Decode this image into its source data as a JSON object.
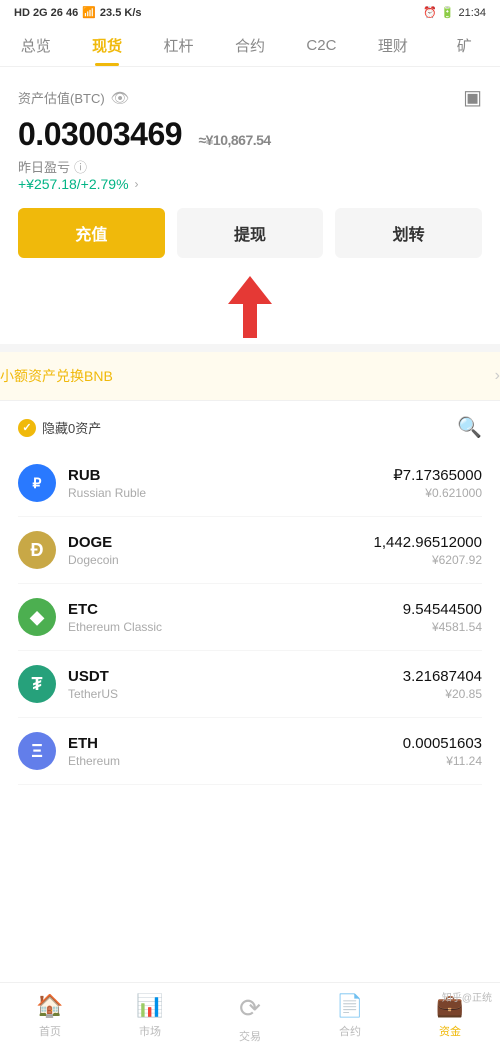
{
  "statusBar": {
    "left": "HD 2G 26 46",
    "network": "23.5 K/s",
    "time": "21:34",
    "battery": "20"
  },
  "navTabs": [
    {
      "id": "overview",
      "label": "总览",
      "active": false
    },
    {
      "id": "spot",
      "label": "现货",
      "active": true
    },
    {
      "id": "leverage",
      "label": "杠杆",
      "active": false
    },
    {
      "id": "contract",
      "label": "合约",
      "active": false
    },
    {
      "id": "c2c",
      "label": "C2C",
      "active": false
    },
    {
      "id": "finance",
      "label": "理财",
      "active": false
    },
    {
      "id": "mining",
      "label": "矿",
      "active": false
    }
  ],
  "asset": {
    "label": "资产估值(BTC)",
    "value": "0.03003469",
    "cny": "≈¥10,867.54",
    "pnlLabel": "昨日盈亏",
    "pnlValue": "+¥257.18/+2.79%"
  },
  "buttons": {
    "recharge": "充值",
    "withdraw": "提现",
    "transfer": "划转"
  },
  "bnbBanner": {
    "text": "小额资产兑换BNB"
  },
  "assetListHeader": {
    "hideZero": "隐藏0资产"
  },
  "coins": [
    {
      "id": "rub",
      "symbol": "RUB",
      "name": "Russian Ruble",
      "amount": "₽7.17365000",
      "cny": "¥0.621000",
      "iconLabel": "₽",
      "iconClass": "rub"
    },
    {
      "id": "doge",
      "symbol": "DOGE",
      "name": "Dogecoin",
      "amount": "1,442.96512000",
      "cny": "¥6207.92",
      "iconLabel": "Ð",
      "iconClass": "doge"
    },
    {
      "id": "etc",
      "symbol": "ETC",
      "name": "Ethereum Classic",
      "amount": "9.54544500",
      "cny": "¥4581.54",
      "iconLabel": "◆",
      "iconClass": "etc"
    },
    {
      "id": "usdt",
      "symbol": "USDT",
      "name": "TetherUS",
      "amount": "3.21687404",
      "cny": "¥20.85",
      "iconLabel": "₮",
      "iconClass": "usdt"
    },
    {
      "id": "eth",
      "symbol": "ETH",
      "name": "Ethereum",
      "amount": "0.00051603",
      "cny": "¥11.24",
      "iconLabel": "Ξ",
      "iconClass": "eth"
    }
  ],
  "bottomNav": [
    {
      "id": "home",
      "label": "首页",
      "icon": "🏠",
      "active": false
    },
    {
      "id": "market",
      "label": "市场",
      "icon": "📊",
      "active": false
    },
    {
      "id": "trade",
      "label": "交易",
      "icon": "🔄",
      "active": false
    },
    {
      "id": "futures",
      "label": "合约",
      "icon": "📄",
      "active": false
    },
    {
      "id": "assets",
      "label": "资金",
      "icon": "💼",
      "active": true
    }
  ]
}
